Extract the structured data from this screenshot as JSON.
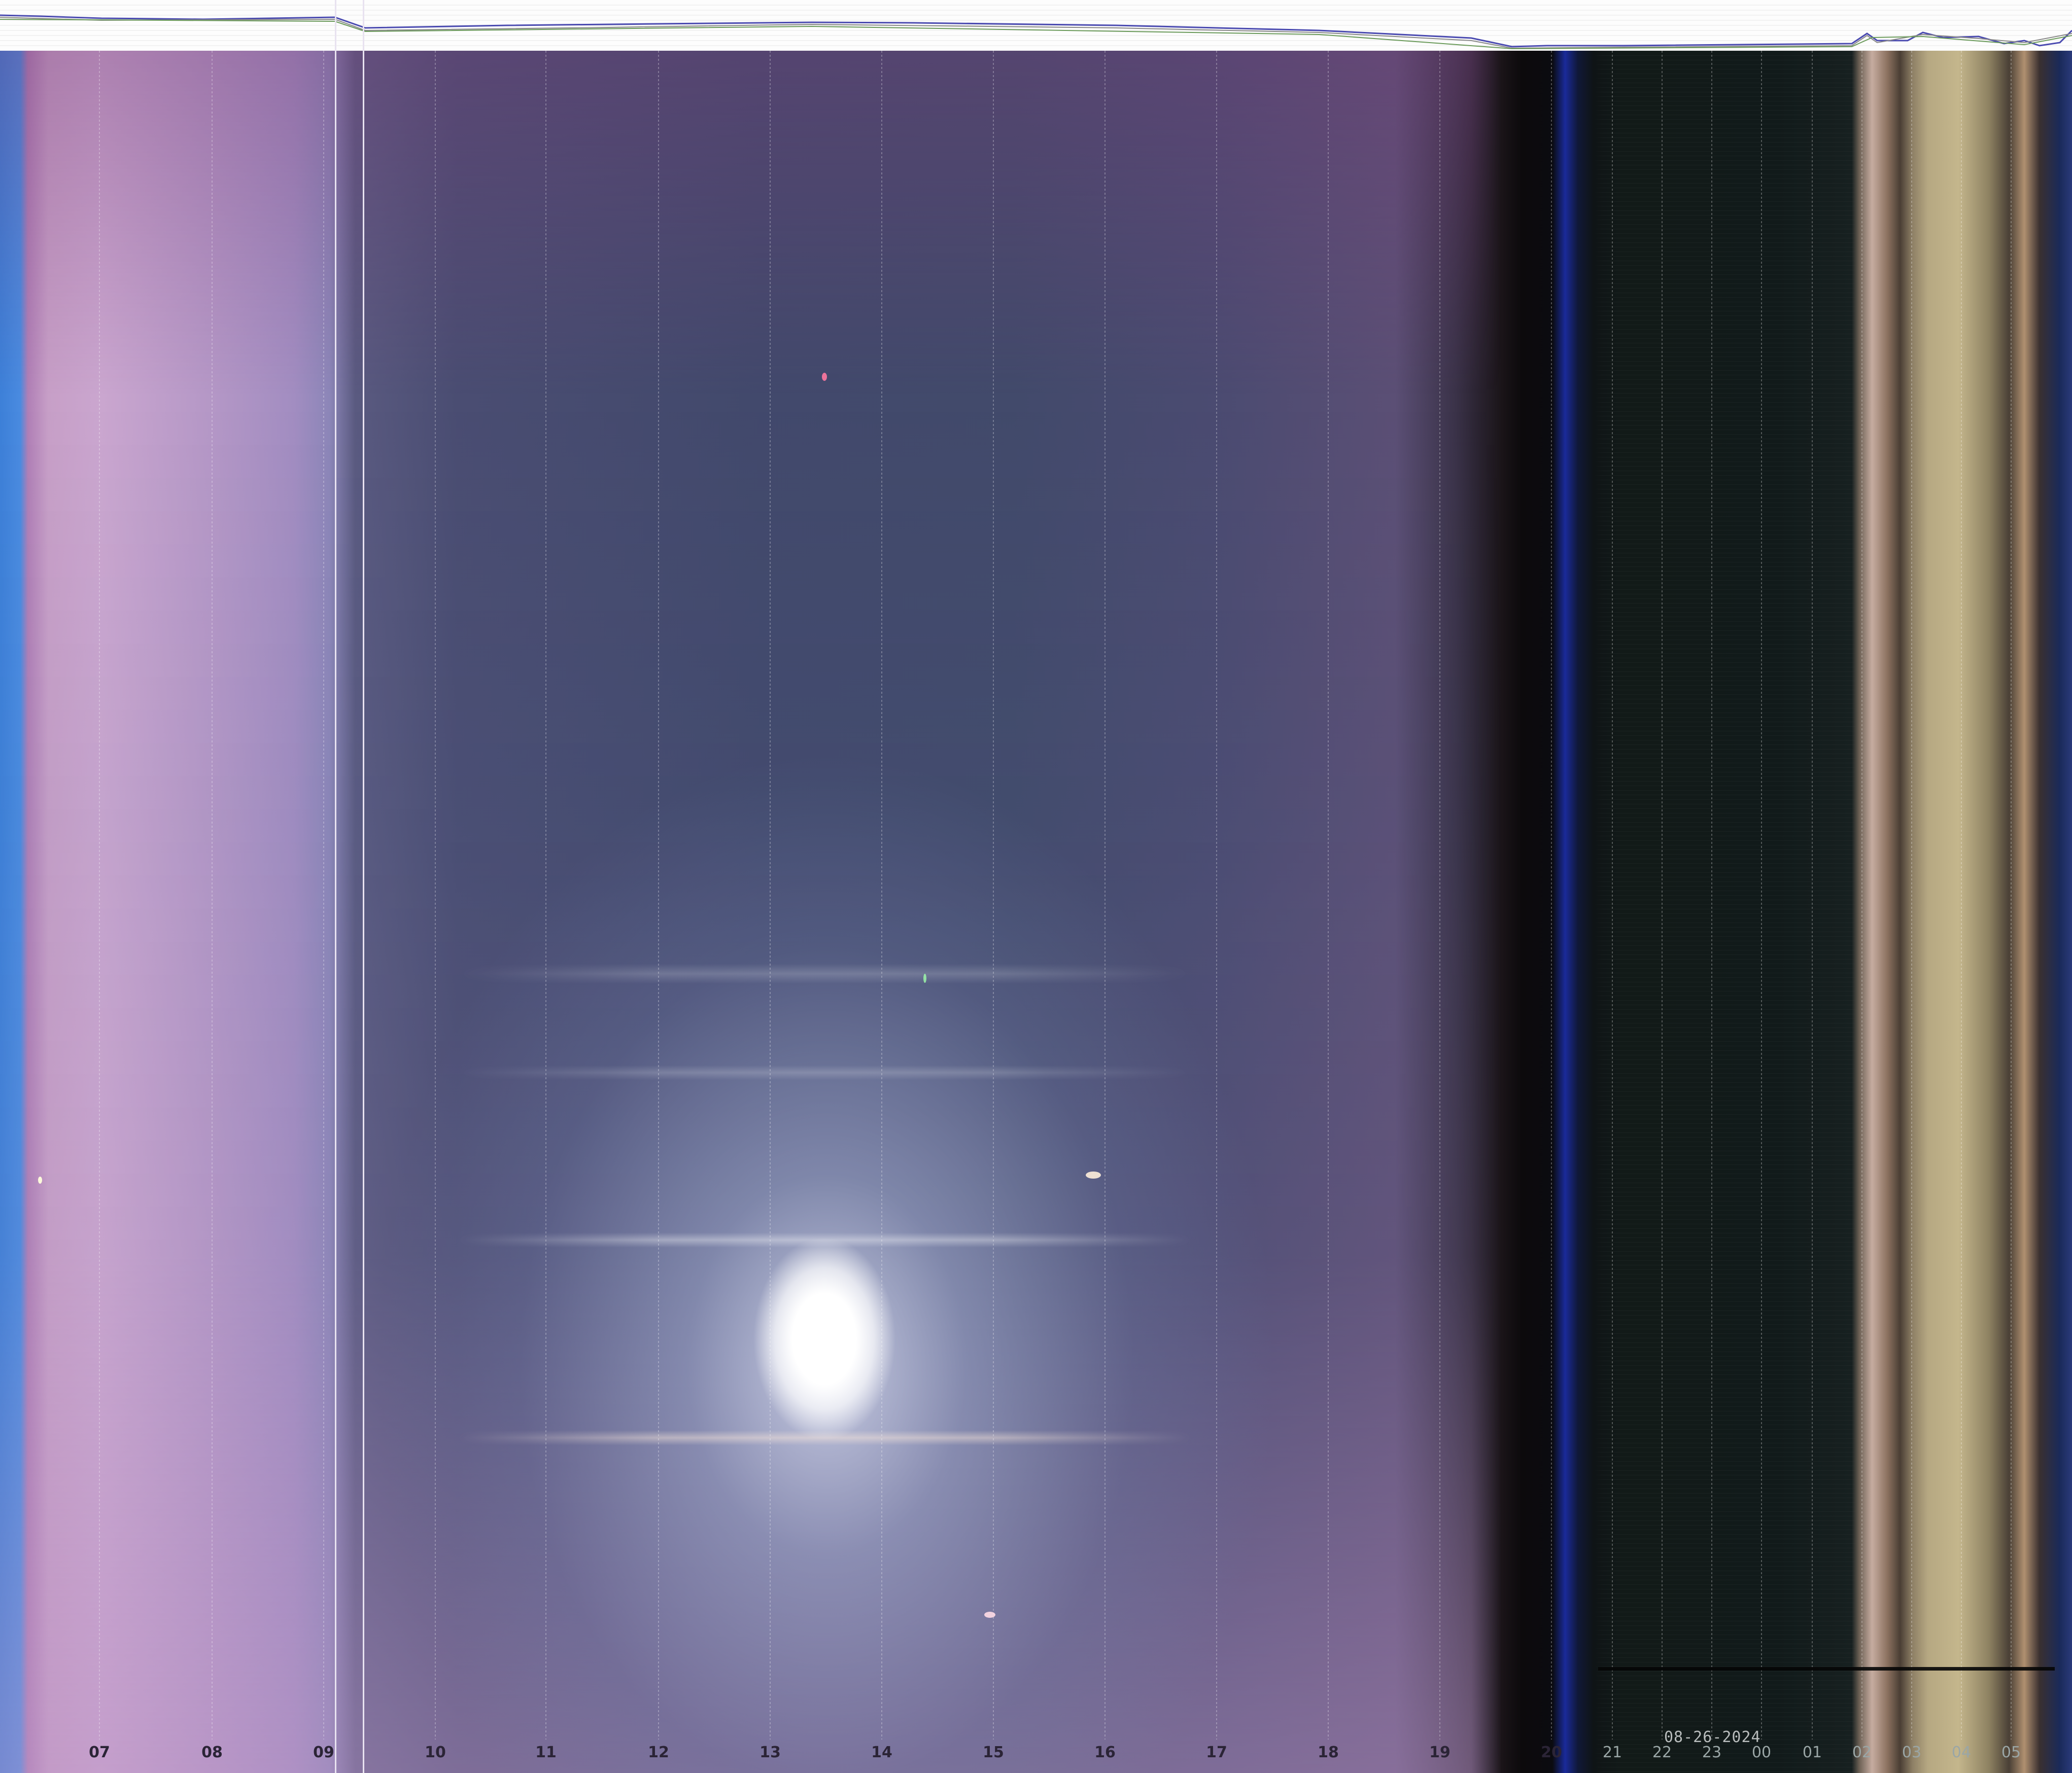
{
  "time_axis": {
    "hour_labels": [
      "07",
      "08",
      "09",
      "10",
      "11",
      "12",
      "13",
      "14",
      "15",
      "16",
      "17",
      "18",
      "19",
      "20",
      "21",
      "22",
      "23",
      "00",
      "01",
      "02",
      "03",
      "04",
      "05"
    ],
    "date_label": "08-26-2024"
  },
  "colors": {
    "day_sky": "#42496c",
    "dawn_pink": "#c79fc7",
    "night_sky": "#121a18",
    "sun_core": "#ffffff",
    "header_background": "#fdfdfd"
  }
}
